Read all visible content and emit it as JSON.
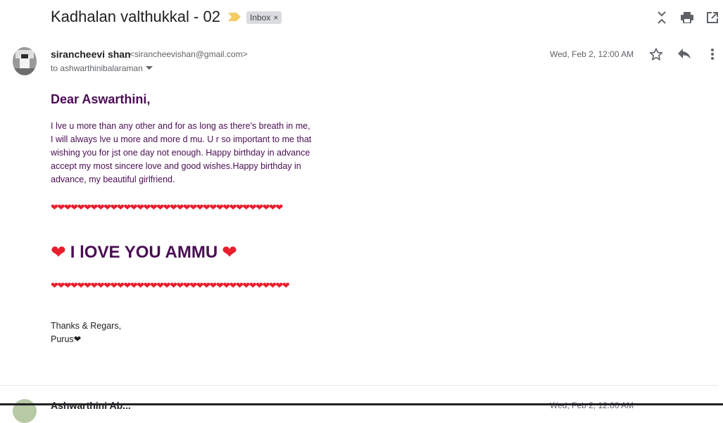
{
  "email": {
    "subject": "Kadhalan valthukkal - 02",
    "label": "Inbox",
    "label_close": "×",
    "sender": {
      "name": "sirancheevi shan",
      "email": "<sirancheevishan@gmail.com>",
      "to": "to ashwarthinibalaraman",
      "date": "Wed, Feb 2, 12:00 AM"
    },
    "body": {
      "greeting": "Dear Aswarthini,",
      "paragraph": "I lve u more than any other and for as long as there's breath in me, I will always lve u more and more d mu. U r so important to me that wishing you for jst one day not enough. Happy birthday in advance accept my most sincere love and good wishes.Happy birthday in advance, my beautiful girlfriend.",
      "hearts_top": "❤❤❤❤❤❤❤❤❤❤❤❤❤❤❤❤❤❤❤❤❤❤❤❤❤❤❤❤❤❤❤❤❤❤❤",
      "love_heart_left": "❤",
      "love_text": "I lOVE YOU AMMU",
      "love_heart_right": "❤",
      "hearts_bottom": "❤❤❤❤❤❤❤❤❤❤❤❤❤❤❤❤❤❤❤❤❤❤❤❤❤❤❤❤❤❤❤❤❤❤❤❤",
      "signoff_line1": "Thanks & Regars,",
      "signoff_line2": "Purus❤"
    }
  },
  "next_message": {
    "name": "Ashwarthini Ab...",
    "date": "Wed, Feb 2, 12:00 AM"
  },
  "colors": {
    "body_text": "#4a0d53",
    "heart": "#ea1d2c",
    "importance": "#f4cc63"
  },
  "icons": [
    "importance-marker-icon",
    "collapse-all-icon",
    "print-icon",
    "open-new-window-icon",
    "star-icon",
    "reply-icon",
    "more-vert-icon",
    "dropdown-arrow-icon"
  ]
}
